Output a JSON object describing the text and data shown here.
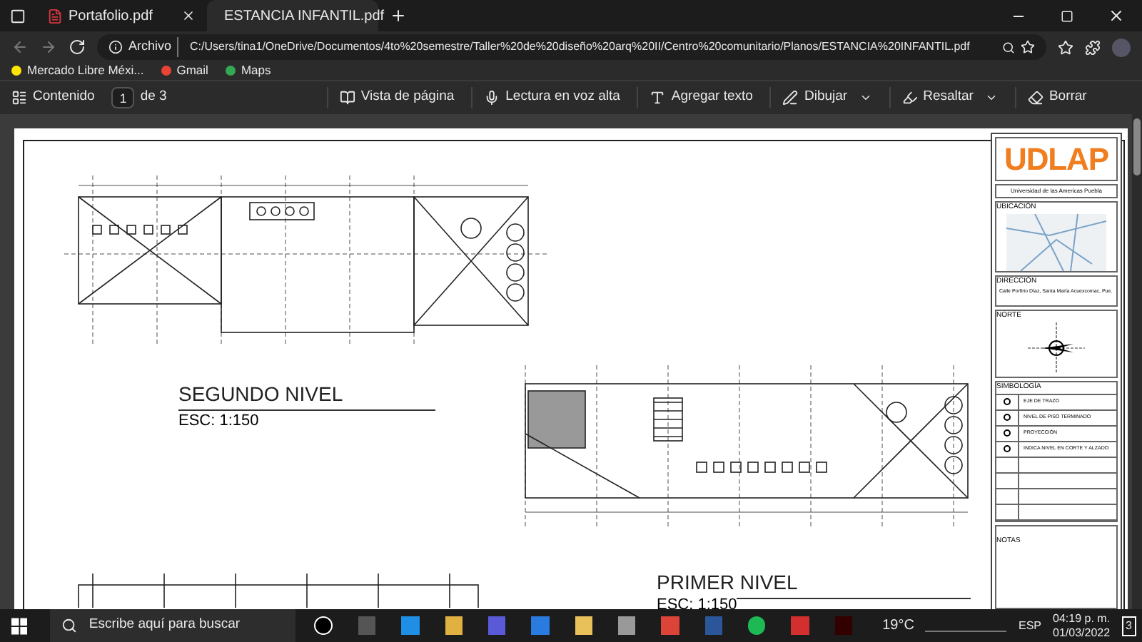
{
  "tabs": [
    {
      "title": "Portafolio.pdf",
      "selected": false
    },
    {
      "title": "ESTANCIA INFANTIL.pdf",
      "selected": true
    }
  ],
  "address": {
    "label": "Archivo",
    "url": "C:/Users/tina1/OneDrive/Documentos/4to%20semestre/Taller%20de%20diseño%20arq%20II/Centro%20comunitario/Planos/ESTANCIA%20INFANTIL.pdf"
  },
  "bookmarks": [
    "Mercado Libre Méxi...",
    "Gmail",
    "Maps"
  ],
  "pdf_toolbar": {
    "contents": "Contenido",
    "page": "1",
    "page_count": "de 3",
    "actions": [
      {
        "label": "Vista de página",
        "dropdown": false
      },
      {
        "label": "Lectura en voz alta",
        "dropdown": false
      },
      {
        "label": "Agregar texto",
        "dropdown": false
      },
      {
        "label": "Dibujar",
        "dropdown": true
      },
      {
        "label": "Resaltar",
        "dropdown": true
      },
      {
        "label": "Borrar",
        "dropdown": false
      }
    ]
  },
  "document": {
    "plans": [
      {
        "title": "SEGUNDO NIVEL",
        "scale": "ESC: 1:150"
      },
      {
        "title": "PRIMER NIVEL",
        "scale": "ESC: 1:150"
      }
    ],
    "title_block": {
      "logo": "UDLAP",
      "institution": "Universidad de las Americas Puebla",
      "location": "UBICACIÓN",
      "address_label": "DIRECCIÓN",
      "address": "Calle Porfirio Díaz, Santa María Acuexcomac, Pue.",
      "north": "NORTE",
      "symbols_label": "SIMBOLOGÍA",
      "symbols": [
        "EJE DE TRAZO",
        "NIVEL DE PISO TERMINADO",
        "PROYECCIÓN",
        "INDICA NIVEL EN CORTE Y ALZADO"
      ],
      "notes": "NOTAS"
    }
  },
  "taskbar": {
    "search": "Escribe aquí para buscar",
    "weather": "19°C",
    "language": "ESP",
    "time": "04:19 p. m.",
    "date": "01/03/2022",
    "notifications": "3"
  }
}
